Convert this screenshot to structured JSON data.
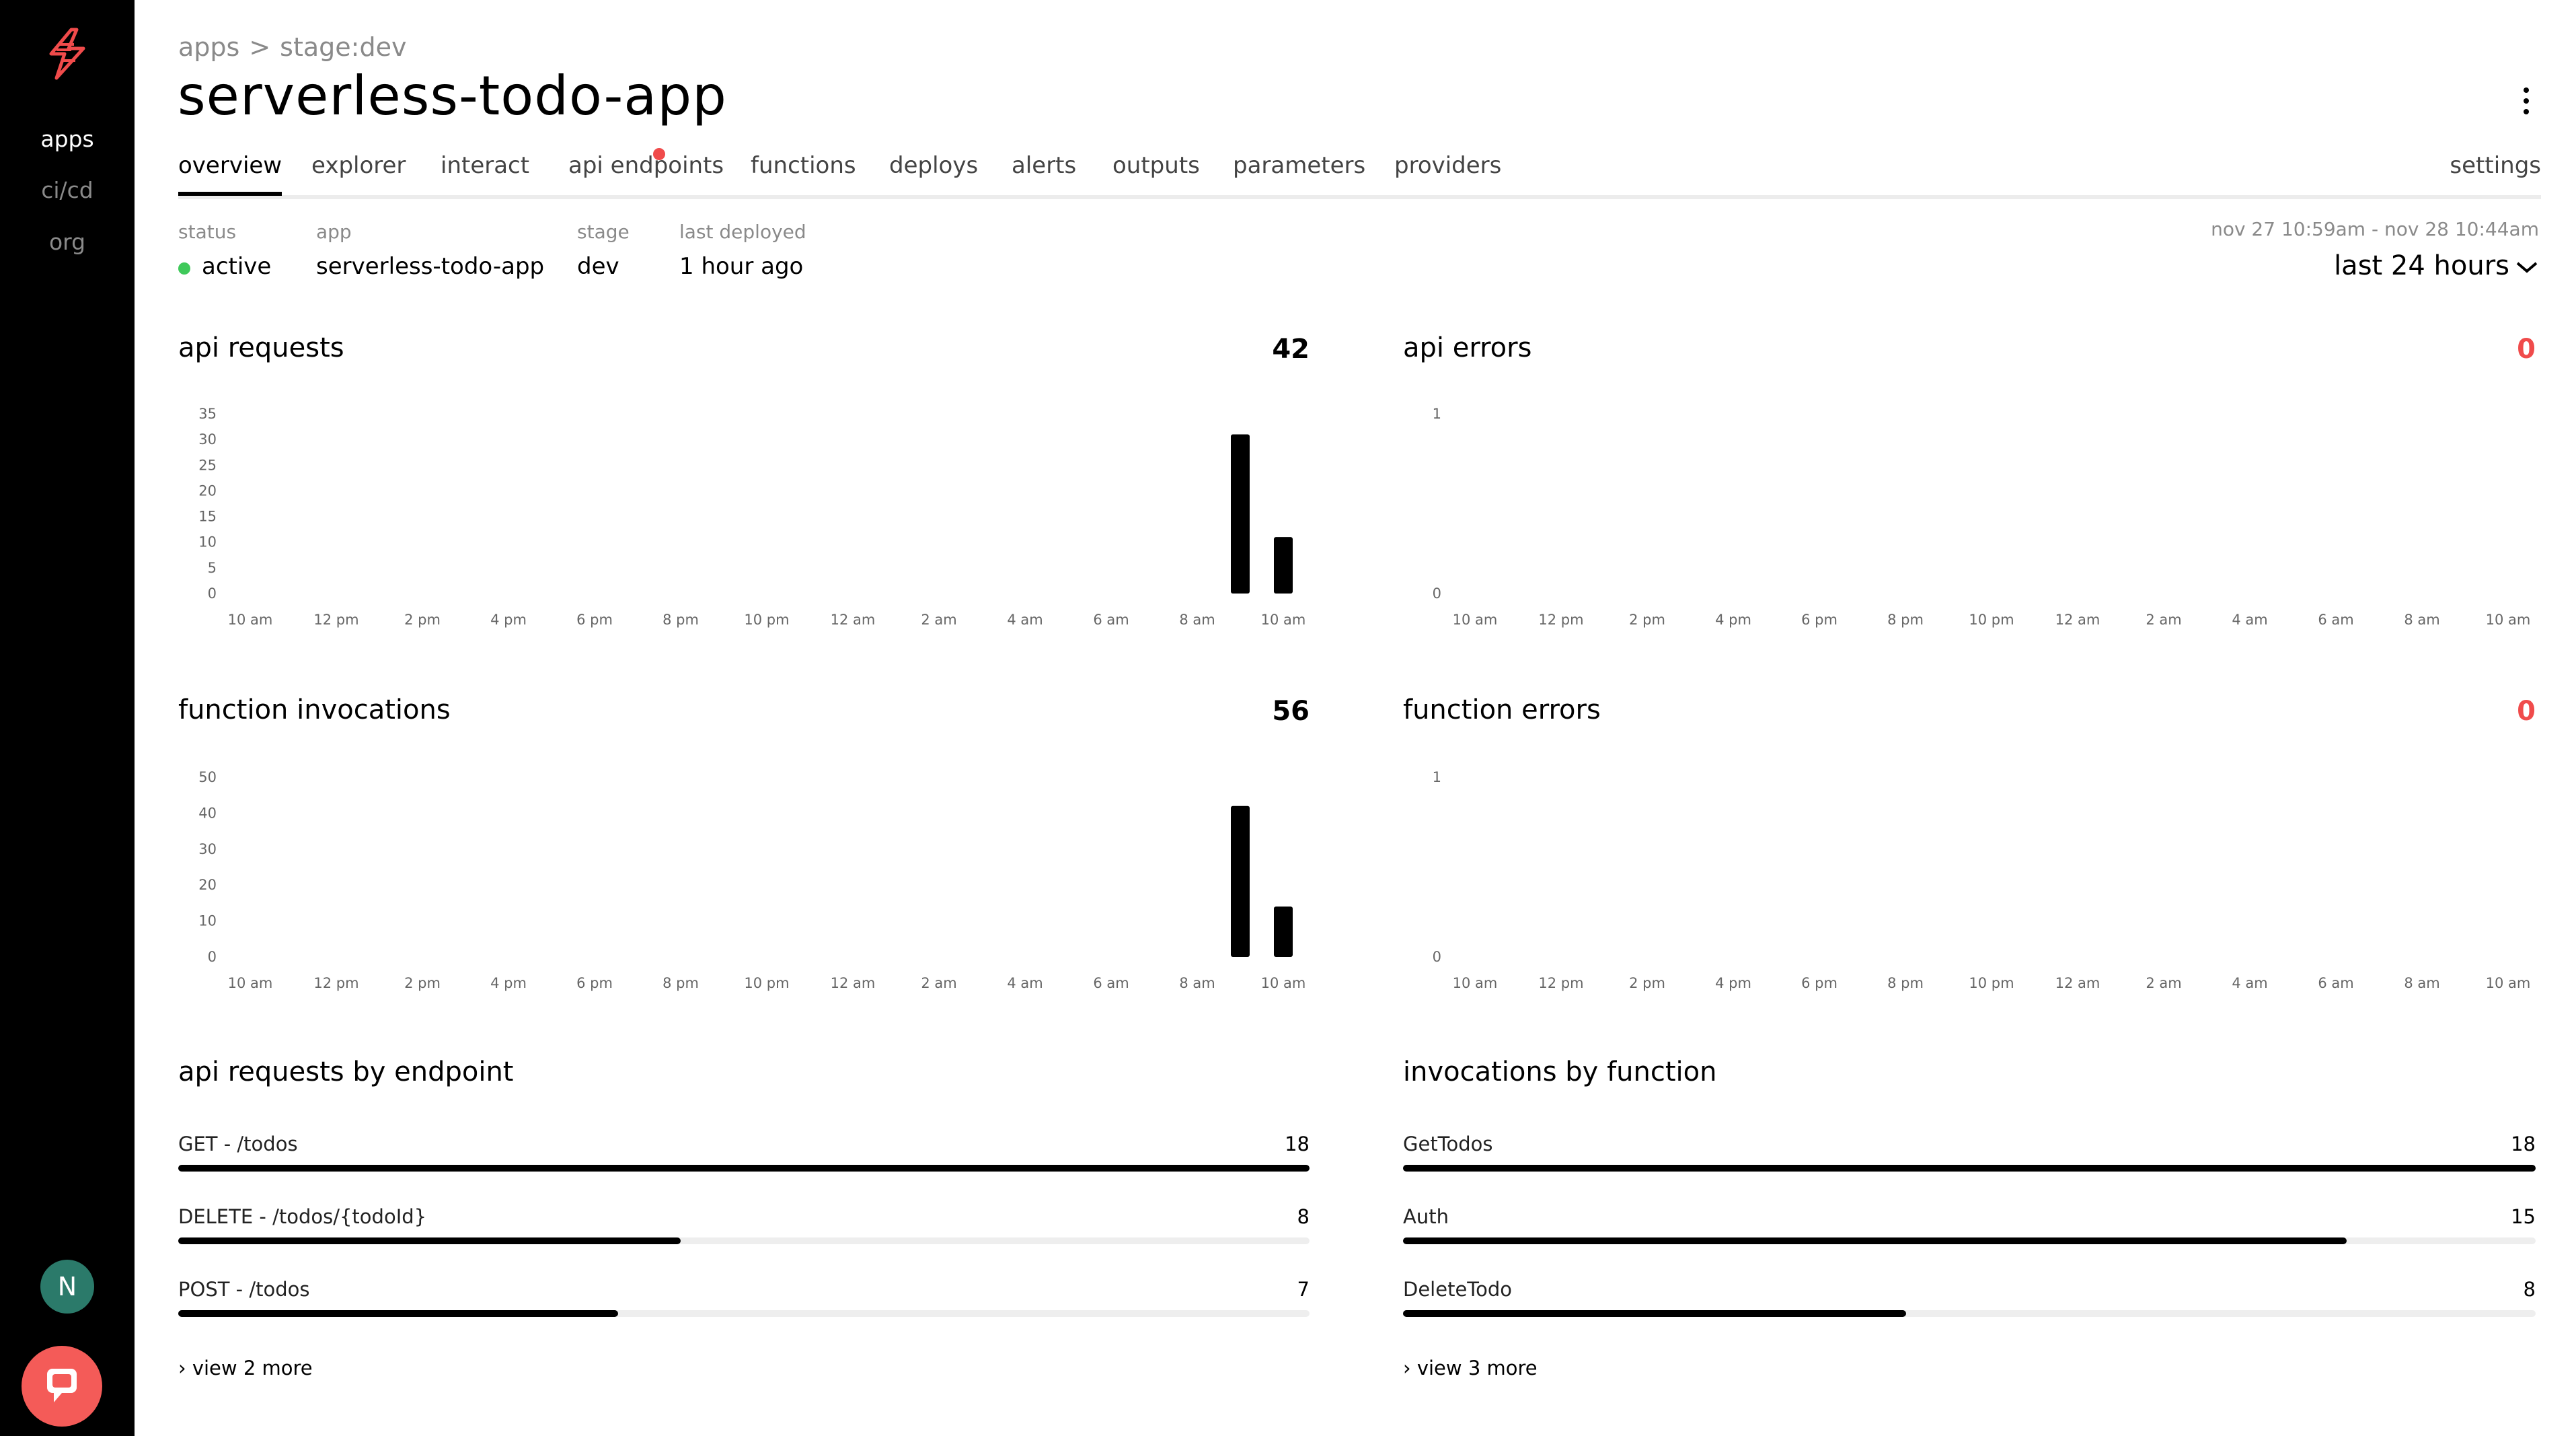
{
  "nav": {
    "apps": "apps",
    "cicd": "ci/cd",
    "org": "org",
    "avatar_initial": "N"
  },
  "breadcrumb": {
    "root": "apps",
    "separator": ">",
    "current": "stage:dev"
  },
  "title": "serverless-todo-app",
  "tabs": [
    {
      "label": "overview"
    },
    {
      "label": "explorer"
    },
    {
      "label": "interact"
    },
    {
      "label": "api endpoints"
    },
    {
      "label": "functions"
    },
    {
      "label": "deploys"
    },
    {
      "label": "alerts"
    },
    {
      "label": "outputs"
    },
    {
      "label": "parameters"
    },
    {
      "label": "providers"
    },
    {
      "label": "settings"
    }
  ],
  "meta": {
    "status_label": "status",
    "status_value": "active",
    "app_label": "app",
    "app_value": "serverless-todo-app",
    "stage_label": "stage",
    "stage_value": "dev",
    "deployed_label": "last deployed",
    "deployed_value": "1 hour ago"
  },
  "range": {
    "span": "nov 27 10:59am - nov 28 10:44am",
    "selected": "last 24 hours"
  },
  "colors": {
    "error": "#f04b4b",
    "status_active": "#3fc95a",
    "bar": "#000000"
  },
  "x_ticks": [
    "10 am",
    "12 pm",
    "2 pm",
    "4 pm",
    "6 pm",
    "8 pm",
    "10 pm",
    "12 am",
    "2 am",
    "4 am",
    "6 am",
    "8 am",
    "10 am"
  ],
  "panels": {
    "api_requests": {
      "title": "api requests",
      "total": "42"
    },
    "api_errors": {
      "title": "api errors",
      "total": "0"
    },
    "function_invocations": {
      "title": "function invocations",
      "total": "56"
    },
    "function_errors": {
      "title": "function errors",
      "total": "0"
    },
    "by_endpoint": {
      "title": "api requests by endpoint",
      "rows": [
        {
          "label": "GET - /todos",
          "value": "18",
          "frac": 1.0
        },
        {
          "label": "DELETE - /todos/{todoId}",
          "value": "8",
          "frac": 0.444
        },
        {
          "label": "POST - /todos",
          "value": "7",
          "frac": 0.389
        }
      ],
      "more": "view 2 more"
    },
    "by_function": {
      "title": "invocations by function",
      "rows": [
        {
          "label": "GetTodos",
          "value": "18",
          "frac": 1.0
        },
        {
          "label": "Auth",
          "value": "15",
          "frac": 0.833
        },
        {
          "label": "DeleteTodo",
          "value": "8",
          "frac": 0.444
        }
      ],
      "more": "view 3 more"
    }
  },
  "chart_data": [
    {
      "type": "bar",
      "title": "api requests",
      "x": [
        "10 am",
        "12 pm",
        "2 pm",
        "4 pm",
        "6 pm",
        "8 pm",
        "10 pm",
        "12 am",
        "2 am",
        "4 am",
        "6 am",
        "8 am",
        "10 am"
      ],
      "yticks": [
        0,
        5,
        10,
        15,
        20,
        25,
        30,
        35
      ],
      "ylim": [
        0,
        35
      ],
      "bars": [
        {
          "hour_index": 23,
          "value": 31
        },
        {
          "hour_index": 24,
          "value": 11
        }
      ]
    },
    {
      "type": "bar",
      "title": "api errors",
      "x": [
        "10 am",
        "12 pm",
        "2 pm",
        "4 pm",
        "6 pm",
        "8 pm",
        "10 pm",
        "12 am",
        "2 am",
        "4 am",
        "6 am",
        "8 am",
        "10 am"
      ],
      "yticks": [
        0,
        1
      ],
      "ylim": [
        0,
        1
      ],
      "bars": []
    },
    {
      "type": "bar",
      "title": "function invocations",
      "x": [
        "10 am",
        "12 pm",
        "2 pm",
        "4 pm",
        "6 pm",
        "8 pm",
        "10 pm",
        "12 am",
        "2 am",
        "4 am",
        "6 am",
        "8 am",
        "10 am"
      ],
      "yticks": [
        0,
        10,
        20,
        30,
        40,
        50
      ],
      "ylim": [
        0,
        50
      ],
      "bars": [
        {
          "hour_index": 23,
          "value": 42
        },
        {
          "hour_index": 24,
          "value": 14
        }
      ]
    },
    {
      "type": "bar",
      "title": "function errors",
      "x": [
        "10 am",
        "12 pm",
        "2 pm",
        "4 pm",
        "6 pm",
        "8 pm",
        "10 pm",
        "12 am",
        "2 am",
        "4 am",
        "6 am",
        "8 am",
        "10 am"
      ],
      "yticks": [
        0,
        1
      ],
      "ylim": [
        0,
        1
      ],
      "bars": []
    }
  ]
}
